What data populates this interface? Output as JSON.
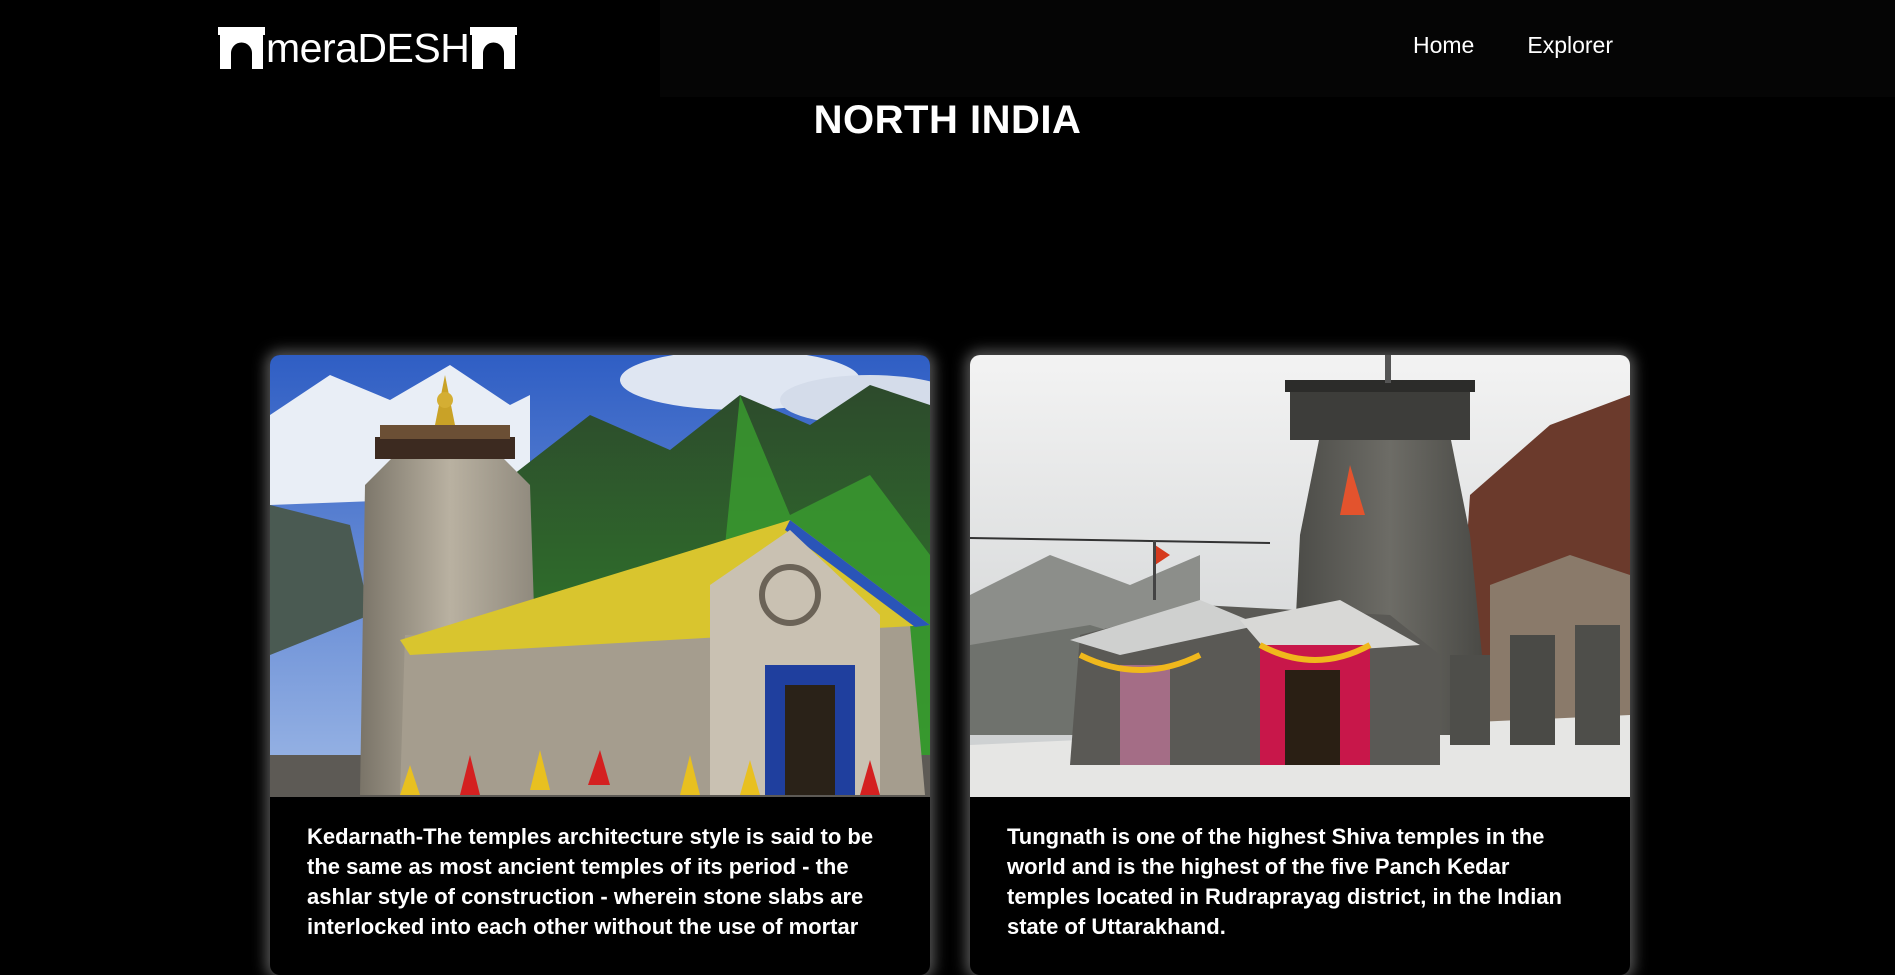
{
  "header": {
    "logo_text": "meraDESH",
    "nav": [
      {
        "label": "Home"
      },
      {
        "label": "Explorer"
      }
    ]
  },
  "page": {
    "title": "NORTH INDIA"
  },
  "cards": [
    {
      "image_subject": "Kedarnath temple with snow-capped mountains",
      "text": "Kedarnath-The temples architecture style is said to be the same as most ancient temples of its period - the ashlar style of construction - wherein stone slabs are interlocked into each other without the use of mortar"
    },
    {
      "image_subject": "Tungnath temple on a misty snowy slope",
      "text": "Tungnath is one of the highest Shiva temples in the world and is the highest of the five Panch Kedar temples located in Rudraprayag district, in the Indian state of Uttarakhand."
    }
  ],
  "colors": {
    "background": "#000000",
    "text": "#ffffff",
    "card_glow": "#ffffff"
  }
}
